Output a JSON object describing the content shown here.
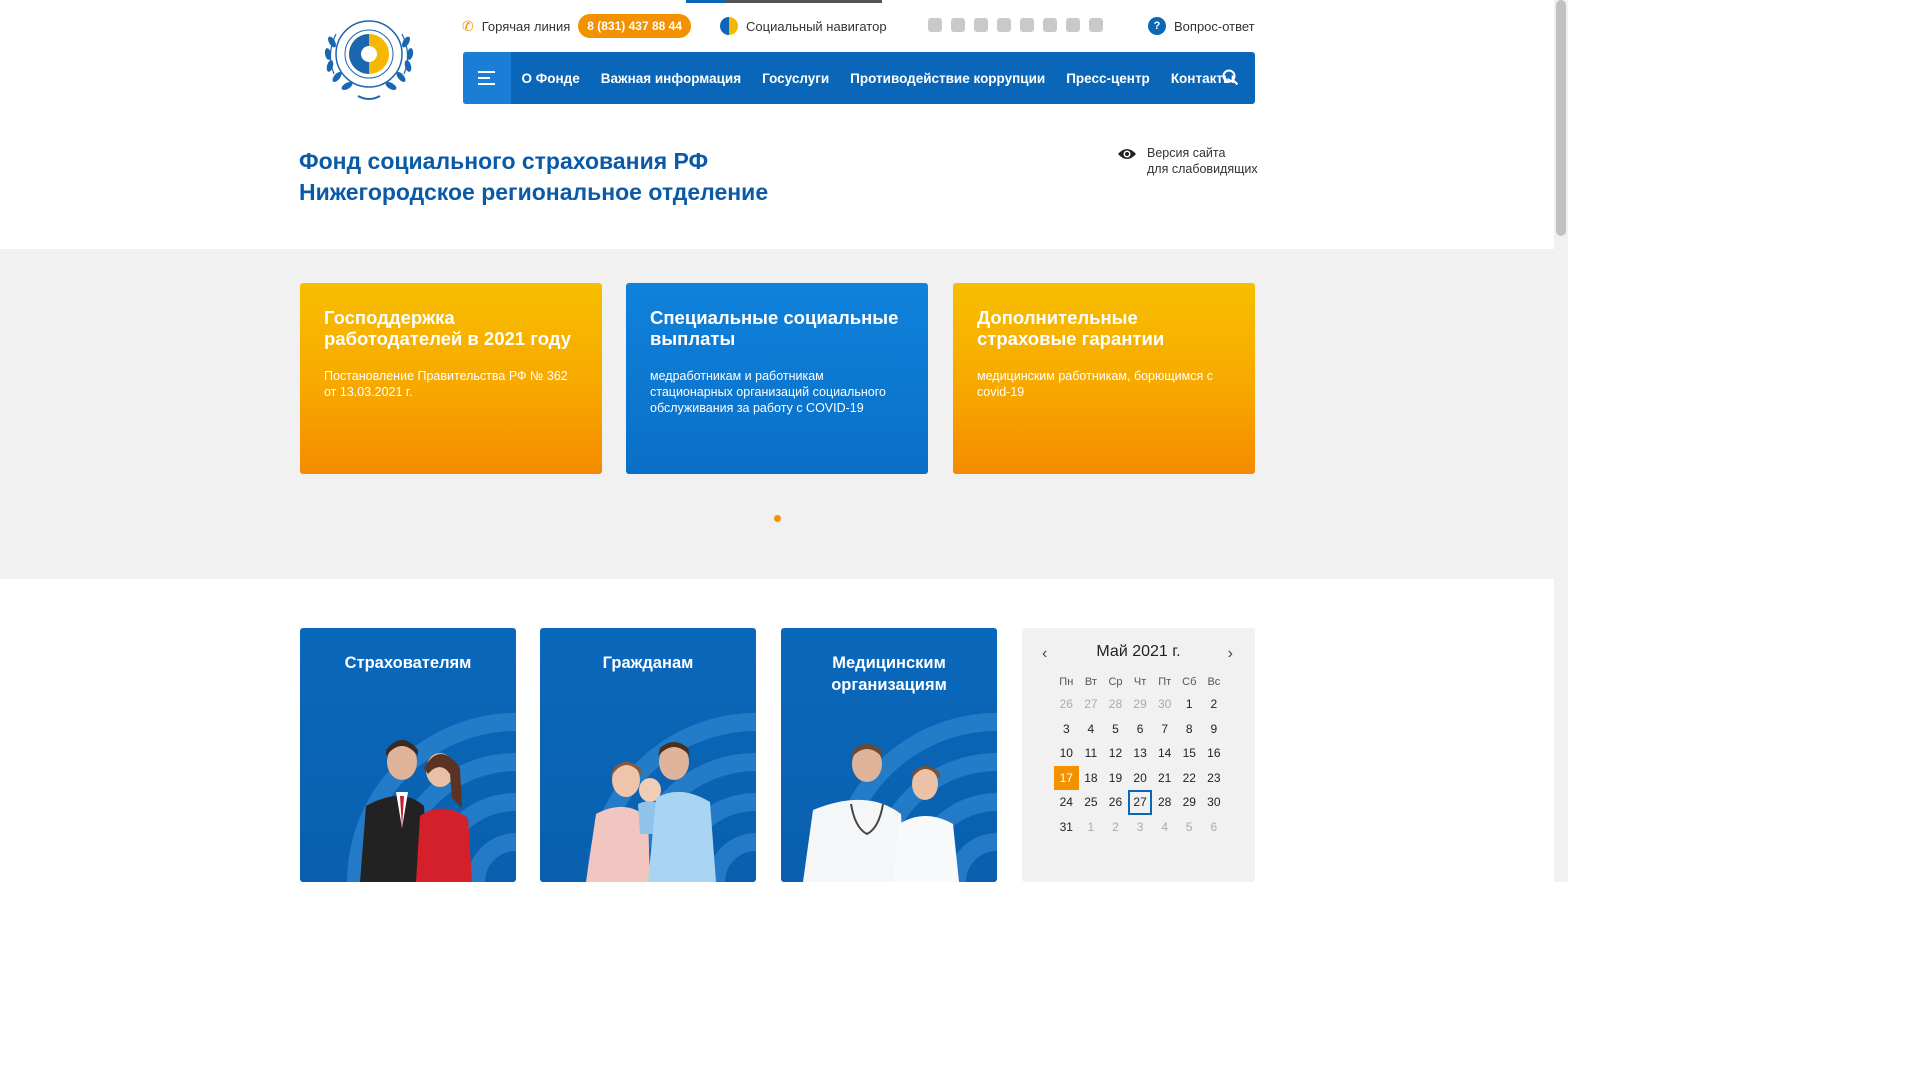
{
  "header": {
    "hotline_label": "Горячая линия",
    "phone": "8 (831) 437 88 44",
    "navigator_label": "Социальный навигатор",
    "socials": [
      "vk-icon",
      "facebook-icon",
      "twitter-icon",
      "odnoklassniki-icon",
      "instagram-icon",
      "telegram-icon",
      "share-icon",
      "rss-icon"
    ],
    "qa_label": "Вопрос-ответ",
    "qa_glyph": "?"
  },
  "nav": {
    "items": [
      "О Фонде",
      "Важная информация",
      "Госуслуги",
      "Противодействие коррупции",
      "Пресс-центр",
      "Контакты"
    ]
  },
  "site_title": {
    "line1": "Фонд социального страхования РФ",
    "line2": "Нижегородское региональное отделение"
  },
  "low_vision": {
    "line1": "Версия сайта",
    "line2": "для слабовидящих"
  },
  "promos": [
    {
      "title": "Господдержка работодателей в 2021 году",
      "text": "Постановление Правительства РФ № 362 от 13.03.2021 г."
    },
    {
      "title": "Специальные социальные выплаты",
      "text": "медработникам и работникам стационарных организаций социального обслуживания за работу с COVID-19"
    },
    {
      "title": "Дополнительные страховые гарантии",
      "text": "медицинским работникам, борющимся с covid-19"
    }
  ],
  "categories": [
    "Страхователям",
    "Гражданам",
    "Медицинским организациям"
  ],
  "calendar": {
    "month": "Май 2021 г.",
    "prev": "‹",
    "next": "›",
    "weekdays": [
      "Пн",
      "Вт",
      "Ср",
      "Чт",
      "Пт",
      "Сб",
      "Вс"
    ],
    "days": [
      {
        "d": "26",
        "m": true
      },
      {
        "d": "27",
        "m": true
      },
      {
        "d": "28",
        "m": true
      },
      {
        "d": "29",
        "m": true
      },
      {
        "d": "30",
        "m": true
      },
      {
        "d": "1"
      },
      {
        "d": "2"
      },
      {
        "d": "3"
      },
      {
        "d": "4"
      },
      {
        "d": "5"
      },
      {
        "d": "6"
      },
      {
        "d": "7"
      },
      {
        "d": "8"
      },
      {
        "d": "9"
      },
      {
        "d": "10"
      },
      {
        "d": "11"
      },
      {
        "d": "12"
      },
      {
        "d": "13"
      },
      {
        "d": "14"
      },
      {
        "d": "15"
      },
      {
        "d": "16"
      },
      {
        "d": "17",
        "today": true
      },
      {
        "d": "18"
      },
      {
        "d": "19"
      },
      {
        "d": "20"
      },
      {
        "d": "21"
      },
      {
        "d": "22"
      },
      {
        "d": "23"
      },
      {
        "d": "24"
      },
      {
        "d": "25"
      },
      {
        "d": "26"
      },
      {
        "d": "27",
        "sel": true
      },
      {
        "d": "28"
      },
      {
        "d": "29"
      },
      {
        "d": "30"
      },
      {
        "d": "31"
      },
      {
        "d": "1",
        "m": true
      },
      {
        "d": "2",
        "m": true
      },
      {
        "d": "3",
        "m": true
      },
      {
        "d": "4",
        "m": true
      },
      {
        "d": "5",
        "m": true
      },
      {
        "d": "6",
        "m": true
      }
    ]
  },
  "colors": {
    "brand_blue": "#0a66b8",
    "accent_orange": "#f39200",
    "band_gray": "#f1f1f1"
  }
}
